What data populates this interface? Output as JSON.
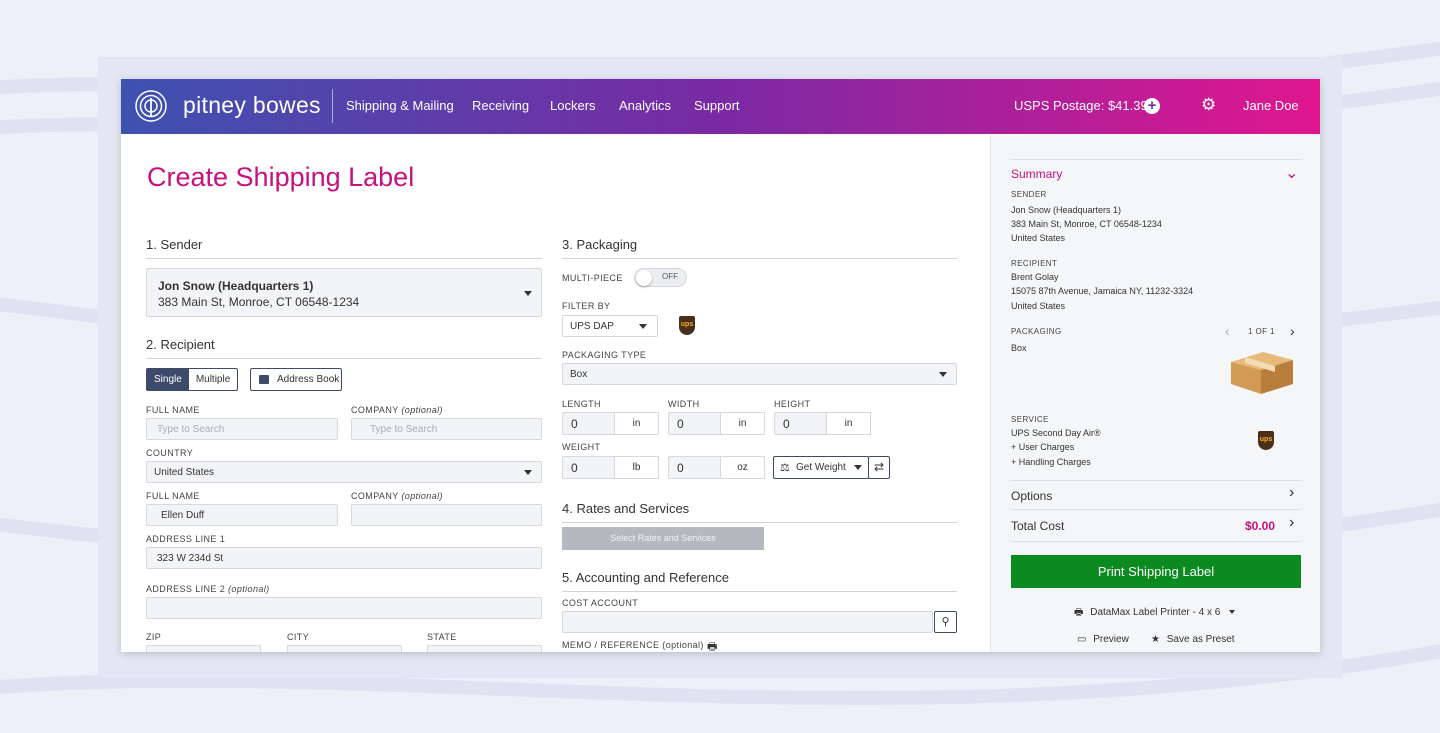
{
  "nav": {
    "brand": "pitney bowes",
    "links": [
      "Shipping & Mailing",
      "Receiving",
      "Lockers",
      "Analytics",
      "Support"
    ],
    "postage": "USPS Postage: $41.39",
    "user": "Jane Doe"
  },
  "page_title": "Create Shipping Label",
  "sender": {
    "heading": "1. Sender",
    "name": "Jon Snow (Headquarters 1)",
    "address": "383 Main St, Monroe, CT 06548-1234"
  },
  "recipient": {
    "heading": "2. Recipient",
    "single": "Single",
    "multiple": "Multiple",
    "address_book": "Address Book",
    "full_name_label": "FULL NAME",
    "company_label": "COMPANY",
    "optional": "(optional)",
    "search_placeholder": "Type to Search",
    "country_label": "COUNTRY",
    "country": "United States",
    "full_name": "Ellen Duff",
    "address1_label": "ADDRESS LINE 1",
    "address1": "323 W 234d St",
    "address2_label": "ADDRESS LINE 2",
    "zip_label": "ZIP",
    "city_label": "CITY",
    "state_label": "STATE"
  },
  "packaging": {
    "heading": "3. Packaging",
    "multi_piece_label": "MULTI-PIECE",
    "toggle": "OFF",
    "filter_label": "FILTER BY",
    "filter_value": "UPS DAP",
    "ups": "ups",
    "type_label": "PACKAGING TYPE",
    "type_value": "Box",
    "length_label": "LENGTH",
    "width_label": "WIDTH",
    "height_label": "HEIGHT",
    "weight_label": "WEIGHT",
    "zero": "0",
    "in": "in",
    "lb": "lb",
    "oz": "oz",
    "get_weight": "Get Weight"
  },
  "rates": {
    "heading": "4. Rates and Services",
    "button": "Select Rates and Services"
  },
  "accounting": {
    "heading": "5. Accounting and Reference",
    "cost_account_label": "COST ACCOUNT",
    "memo_label": "MEMO / REFERENCE (optional)"
  },
  "summary": {
    "title": "Summary",
    "sender_label": "SENDER",
    "sender_lines": [
      "Jon Snow (Headquarters 1)",
      "383 Main St, Monroe, CT 06548-1234",
      "United States"
    ],
    "recipient_label": "RECIPIENT",
    "recipient_lines": [
      "Brent Golay",
      "15075 87th Avenue, Jamaica NY, 11232-3324",
      "United States"
    ],
    "packaging_label": "PACKAGING",
    "packaging_value": "Box",
    "pager": "1 OF 1",
    "service_label": "SERVICE",
    "service_lines": [
      "UPS Second Day Air®",
      "+ User Charges",
      "+ Handling Charges"
    ],
    "options": "Options",
    "total_label": "Total Cost",
    "total_value": "$0.00",
    "print": "Print Shipping Label",
    "printer": "DataMax Label Printer - 4 x 6",
    "preview": "Preview",
    "preset": "Save as Preset"
  },
  "colors": {
    "accent": "#c8107e",
    "nav_start": "#3e52b0",
    "nav_end": "#e0168f",
    "print": "#0a8a1f"
  }
}
